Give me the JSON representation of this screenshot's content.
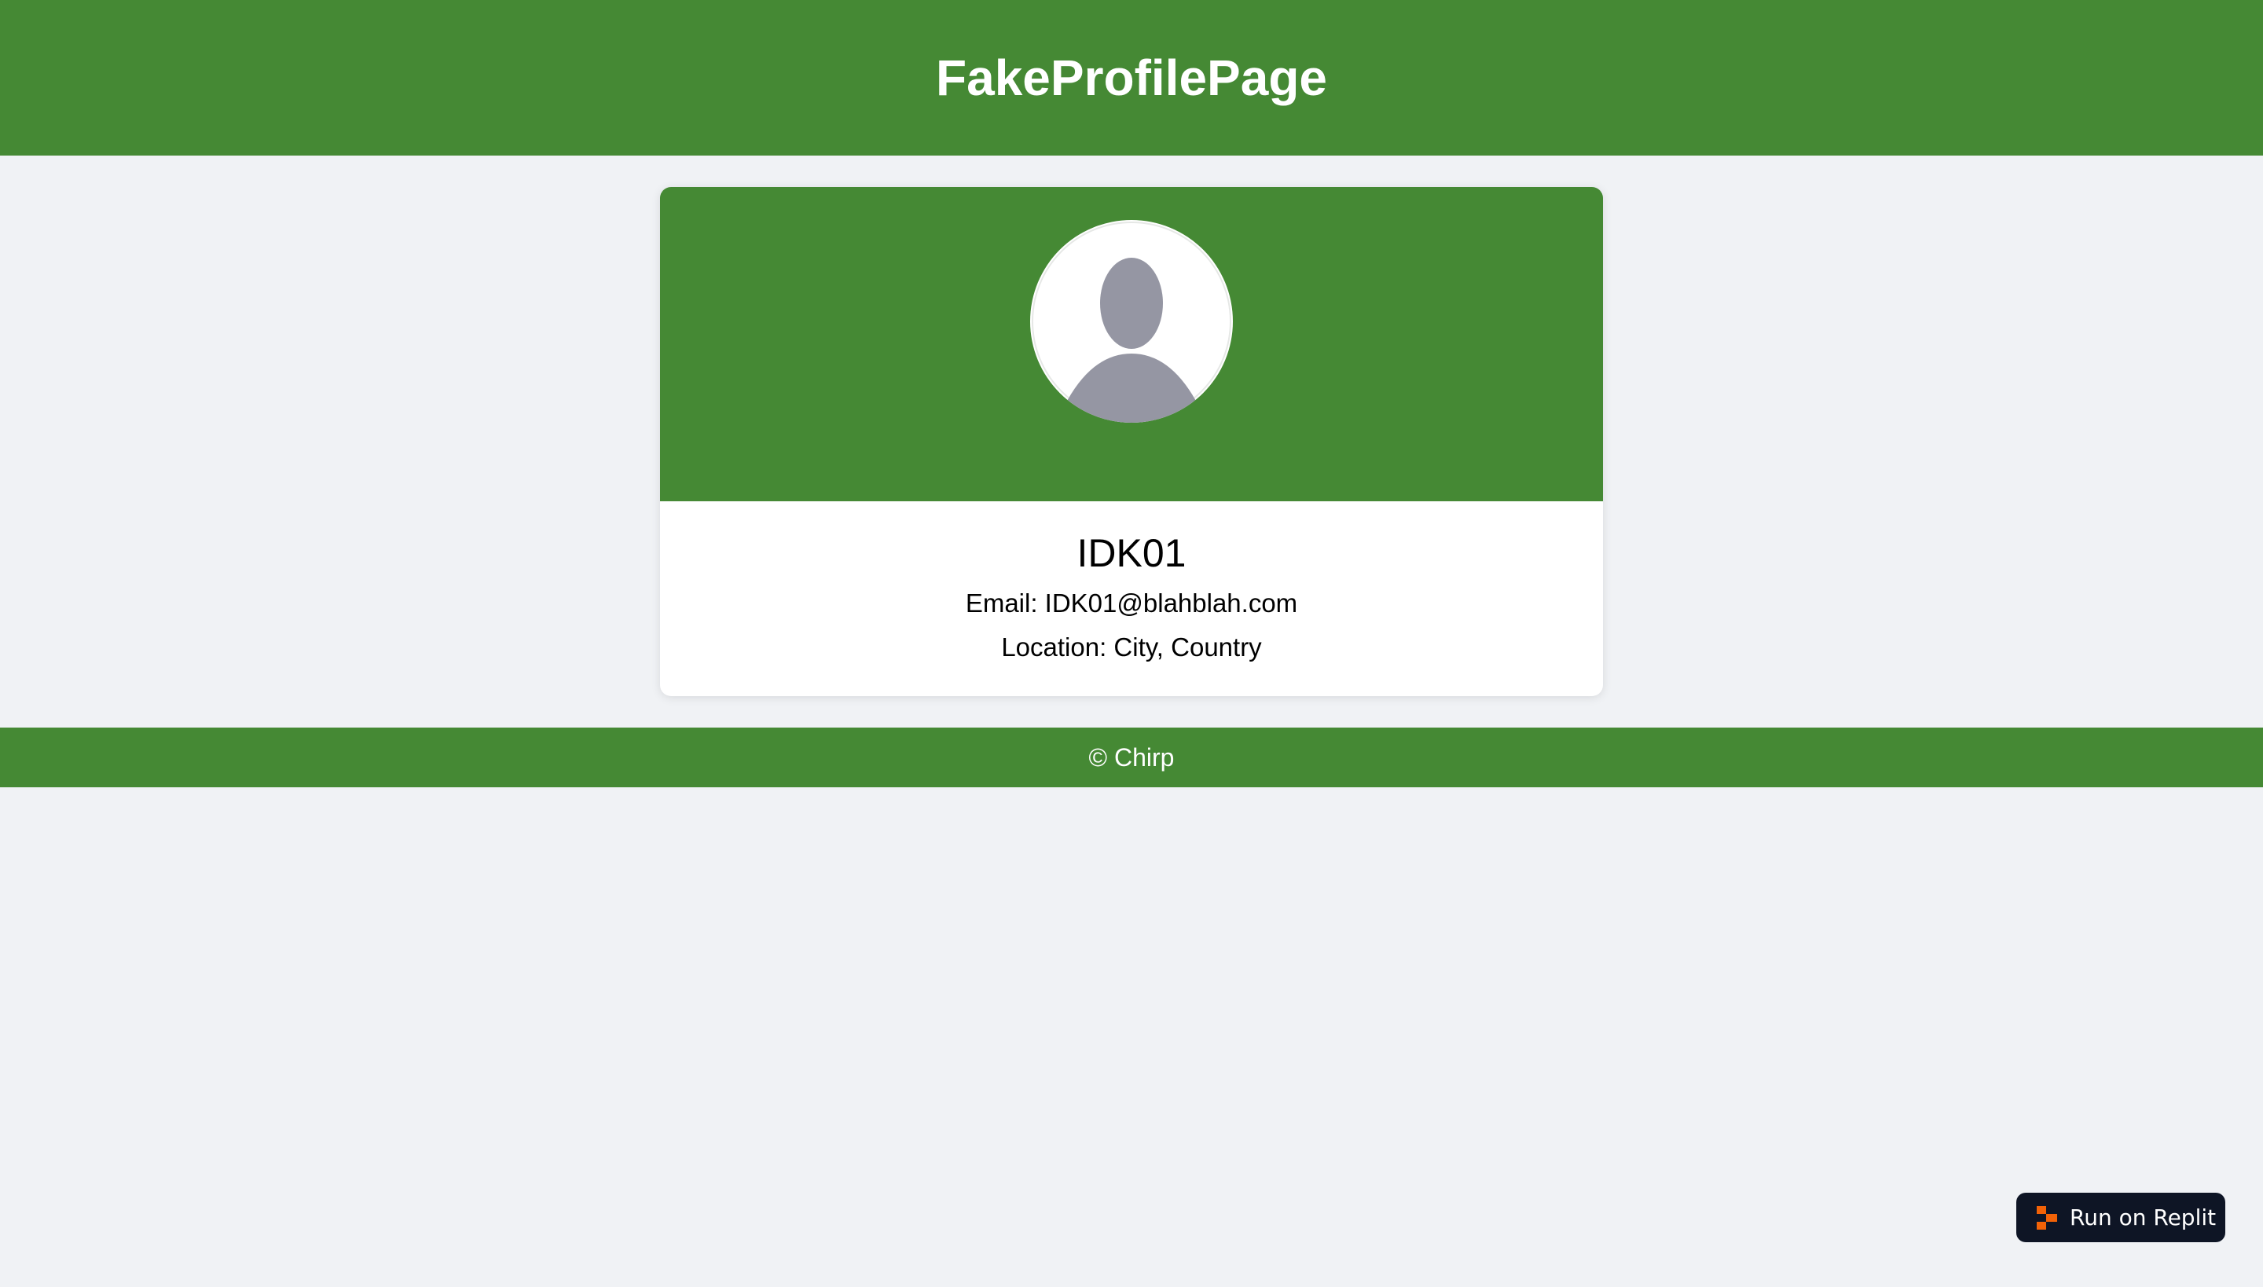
{
  "header": {
    "title": "FakeProfilePage"
  },
  "profile": {
    "username": "IDK01",
    "email": "Email: IDK01@blahblah.com",
    "location": "Location: City, Country",
    "avatar_icon": "default-user-avatar-icon"
  },
  "footer": {
    "text": "© Chirp"
  },
  "replit": {
    "label": "Run on Replit",
    "icon": "replit-logo-icon"
  },
  "colors": {
    "primary_green": "#458934",
    "page_bg": "#f0f2f5",
    "card_bg": "#ffffff",
    "avatar_gray": "#9596a3",
    "replit_button_bg": "#0e1525",
    "replit_orange": "#f26207"
  }
}
